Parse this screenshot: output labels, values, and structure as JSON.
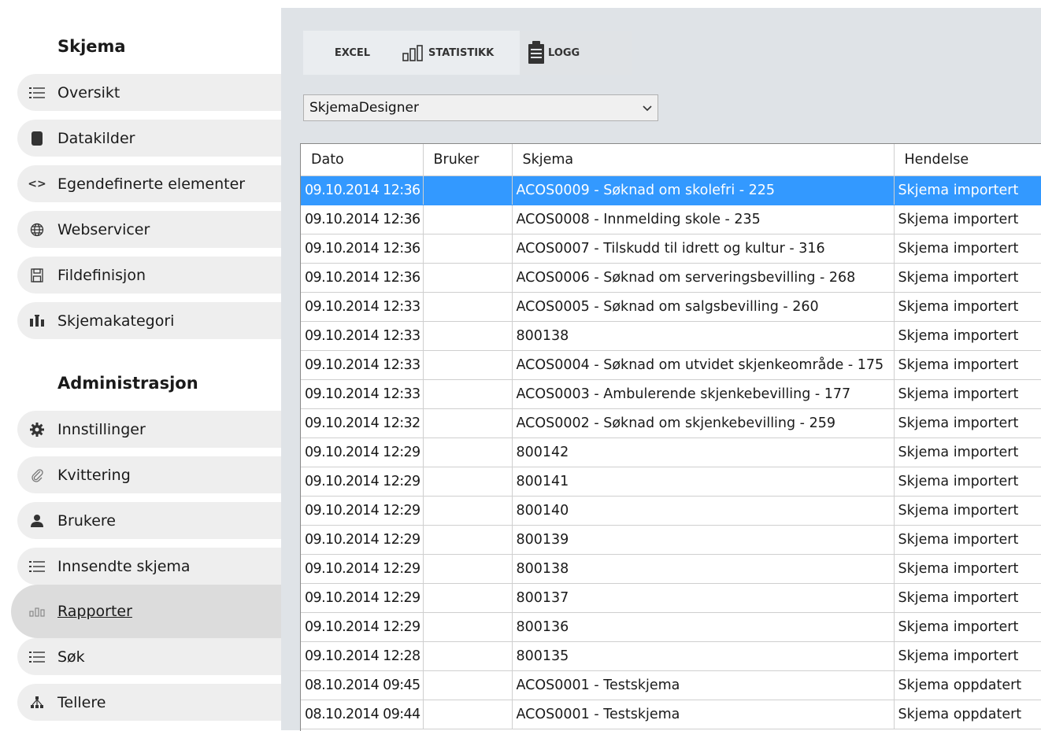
{
  "sidebar": {
    "section_skjema": "Skjema",
    "section_admin": "Administrasjon",
    "items": [
      {
        "label": "Oversikt",
        "icon": "list-icon"
      },
      {
        "label": "Datakilder",
        "icon": "database-icon"
      },
      {
        "label": "Egendefinerte elementer",
        "icon": "code-icon"
      },
      {
        "label": "Webservicer",
        "icon": "globe-icon"
      },
      {
        "label": "Fildefinisjon",
        "icon": "file-icon"
      },
      {
        "label": "Skjemakategori",
        "icon": "category-icon"
      },
      {
        "label": "Innstillinger",
        "icon": "gear-icon"
      },
      {
        "label": "Kvittering",
        "icon": "paperclip-icon"
      },
      {
        "label": "Brukere",
        "icon": "user-icon"
      },
      {
        "label": "Innsendte skjema",
        "icon": "list-icon"
      },
      {
        "label": "Rapporter",
        "icon": "chart-icon",
        "active": true
      },
      {
        "label": "Søk",
        "icon": "list-icon"
      },
      {
        "label": "Tellere",
        "icon": "hierarchy-icon"
      }
    ]
  },
  "toolbar": {
    "excel": "EXCEL",
    "statistikk": "STATISTIKK",
    "logg": "LOGG"
  },
  "dropdown": {
    "selected": "SkjemaDesigner"
  },
  "table": {
    "columns": [
      "Dato",
      "Bruker",
      "Skjema",
      "Hendelse"
    ],
    "rows": [
      [
        "09.10.2014 12:36",
        "",
        "ACOS0009 - Søknad om skolefri - 225",
        "Skjema importert"
      ],
      [
        "09.10.2014 12:36",
        "",
        "ACOS0008 - Innmelding skole - 235",
        "Skjema importert"
      ],
      [
        "09.10.2014 12:36",
        "",
        "ACOS0007 - Tilskudd til idrett og kultur - 316",
        "Skjema importert"
      ],
      [
        "09.10.2014 12:36",
        "",
        "ACOS0006 - Søknad om serveringsbevilling - 268",
        "Skjema importert"
      ],
      [
        "09.10.2014 12:33",
        "",
        "ACOS0005 - Søknad om salgsbevilling - 260",
        "Skjema importert"
      ],
      [
        "09.10.2014 12:33",
        "",
        "800138",
        "Skjema importert"
      ],
      [
        "09.10.2014 12:33",
        "",
        "ACOS0004 - Søknad om utvidet skjenkeområde - 175",
        "Skjema importert"
      ],
      [
        "09.10.2014 12:33",
        "",
        "ACOS0003 - Ambulerende skjenkebevilling - 177",
        "Skjema importert"
      ],
      [
        "09.10.2014 12:32",
        "",
        "ACOS0002 - Søknad om skjenkebevilling - 259",
        "Skjema importert"
      ],
      [
        "09.10.2014 12:29",
        "",
        "800142",
        "Skjema importert"
      ],
      [
        "09.10.2014 12:29",
        "",
        "800141",
        "Skjema importert"
      ],
      [
        "09.10.2014 12:29",
        "",
        "800140",
        "Skjema importert"
      ],
      [
        "09.10.2014 12:29",
        "",
        "800139",
        "Skjema importert"
      ],
      [
        "09.10.2014 12:29",
        "",
        "800138",
        "Skjema importert"
      ],
      [
        "09.10.2014 12:29",
        "",
        "800137",
        "Skjema importert"
      ],
      [
        "09.10.2014 12:29",
        "",
        "800136",
        "Skjema importert"
      ],
      [
        "09.10.2014 12:28",
        "",
        "800135",
        "Skjema importert"
      ],
      [
        "08.10.2014 09:45",
        "",
        "ACOS0001 - Testskjema",
        "Skjema oppdatert"
      ],
      [
        "08.10.2014 09:44",
        "",
        "ACOS0001 - Testskjema",
        "Skjema oppdatert"
      ]
    ],
    "selected_row": 0
  },
  "colors": {
    "selection": "#3399ff",
    "main_bg": "#dfe3e7"
  }
}
